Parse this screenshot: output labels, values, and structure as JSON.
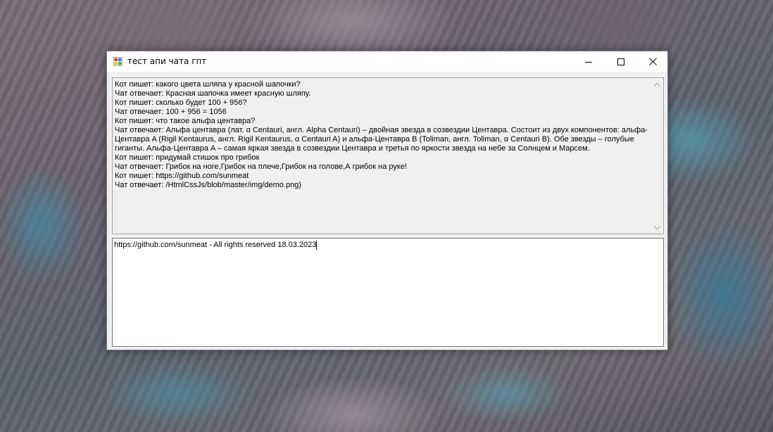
{
  "window": {
    "title": "тест апи чата гпт"
  },
  "output": {
    "lines": [
      "Кот пишет: какого цвета шляпа у красной шапочки?",
      "Чат отвечает: Красная шапочка имеет красную шляпу.",
      "Кот пишет: сколько будет 100 + 956?",
      "Чат отвечает: 100 + 956 = 1056",
      "Кот пишет: что такое альфа центавра?",
      "Чат отвечает: Альфа центавра (лат. α Centauri, англ. Alpha Centauri) – двойная звезда в созвездии Центавра. Состоит из двух компонентов: альфа-",
      "Центавра A (Rigil Kentaurus, англ. Rigil Kentaurus, α Centauri A) и альфа-Центавра B (Toliman, англ. Toliman, α Centauri B). Обе звезды – голубые",
      "гиганты. Альфа-Центавра A – самая яркая звезда в созвездии Центавра и третья по яркости звезда на небе за Солнцем и Марсем.",
      "Кот пишет: придумай стишок про грибок",
      "Чат отвечает: Грибок на ноге,Грибок на плече,Грибок на голове,А грибок на руке!",
      "Кот пишет: https://github.com/sunmeat",
      "Чат отвечает: /HtmlCssJs/blob/master/img/demo.png)"
    ]
  },
  "input": {
    "value": "https://github.com/sunmeat - All rights reserved 18.03.2023"
  },
  "icons": {
    "app": "app-window-icon",
    "minimize": "minimize-icon",
    "maximize": "maximize-icon",
    "close": "close-icon",
    "scroll_up": "chevron-up-icon",
    "scroll_down": "chevron-down-icon"
  }
}
